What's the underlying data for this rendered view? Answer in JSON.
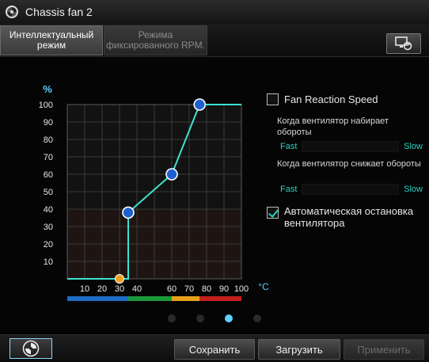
{
  "window": {
    "title": "Chassis fan 2"
  },
  "tabs": [
    {
      "label": "Интеллектуальный режим",
      "active": true
    },
    {
      "label": "Режима фиксированного RPM.",
      "active": false
    }
  ],
  "chart_data": {
    "type": "line",
    "ylabel": "%",
    "xlabel": "°C",
    "x_ticks": [
      10,
      20,
      30,
      40,
      60,
      70,
      80,
      90,
      100
    ],
    "y_ticks": [
      10,
      20,
      30,
      40,
      50,
      60,
      70,
      80,
      90,
      100
    ],
    "xlim": [
      0,
      100
    ],
    "ylim": [
      0,
      100
    ],
    "points": [
      {
        "x": 30,
        "y": 0
      },
      {
        "x": 35,
        "y": 38
      },
      {
        "x": 60,
        "y": 60
      },
      {
        "x": 76,
        "y": 100
      }
    ],
    "curve": [
      [
        0,
        0
      ],
      [
        35,
        0
      ],
      [
        35,
        38
      ],
      [
        60,
        60
      ],
      [
        76,
        100
      ],
      [
        100,
        100
      ]
    ],
    "temperature_bands": [
      {
        "from": 0,
        "to": 35,
        "color": "#1f6cc4"
      },
      {
        "from": 35,
        "to": 60,
        "color": "#1a9a3a"
      },
      {
        "from": 60,
        "to": 76,
        "color": "#e8a21a"
      },
      {
        "from": 76,
        "to": 100,
        "color": "#c42020"
      }
    ],
    "colors": {
      "curve": "#3fe0d0",
      "point": "#1f5fd0",
      "start_point": "#f0a020"
    }
  },
  "settings": {
    "fan_reaction_speed": {
      "label": "Fan Reaction Speed",
      "checked": false
    },
    "spin_up": {
      "label": "Когда вентилятор набирает обороты",
      "fast": "Fast",
      "slow": "Slow"
    },
    "spin_down": {
      "label": "Когда вентилятор снижает обороты",
      "fast": "Fast",
      "slow": "Slow"
    },
    "auto_stop": {
      "label": "Автоматическая остановка вентилятора",
      "checked": true
    }
  },
  "pagination": {
    "count": 4,
    "active": 3
  },
  "footer": {
    "save": "Сохранить",
    "load": "Загрузить",
    "apply": "Применить"
  }
}
